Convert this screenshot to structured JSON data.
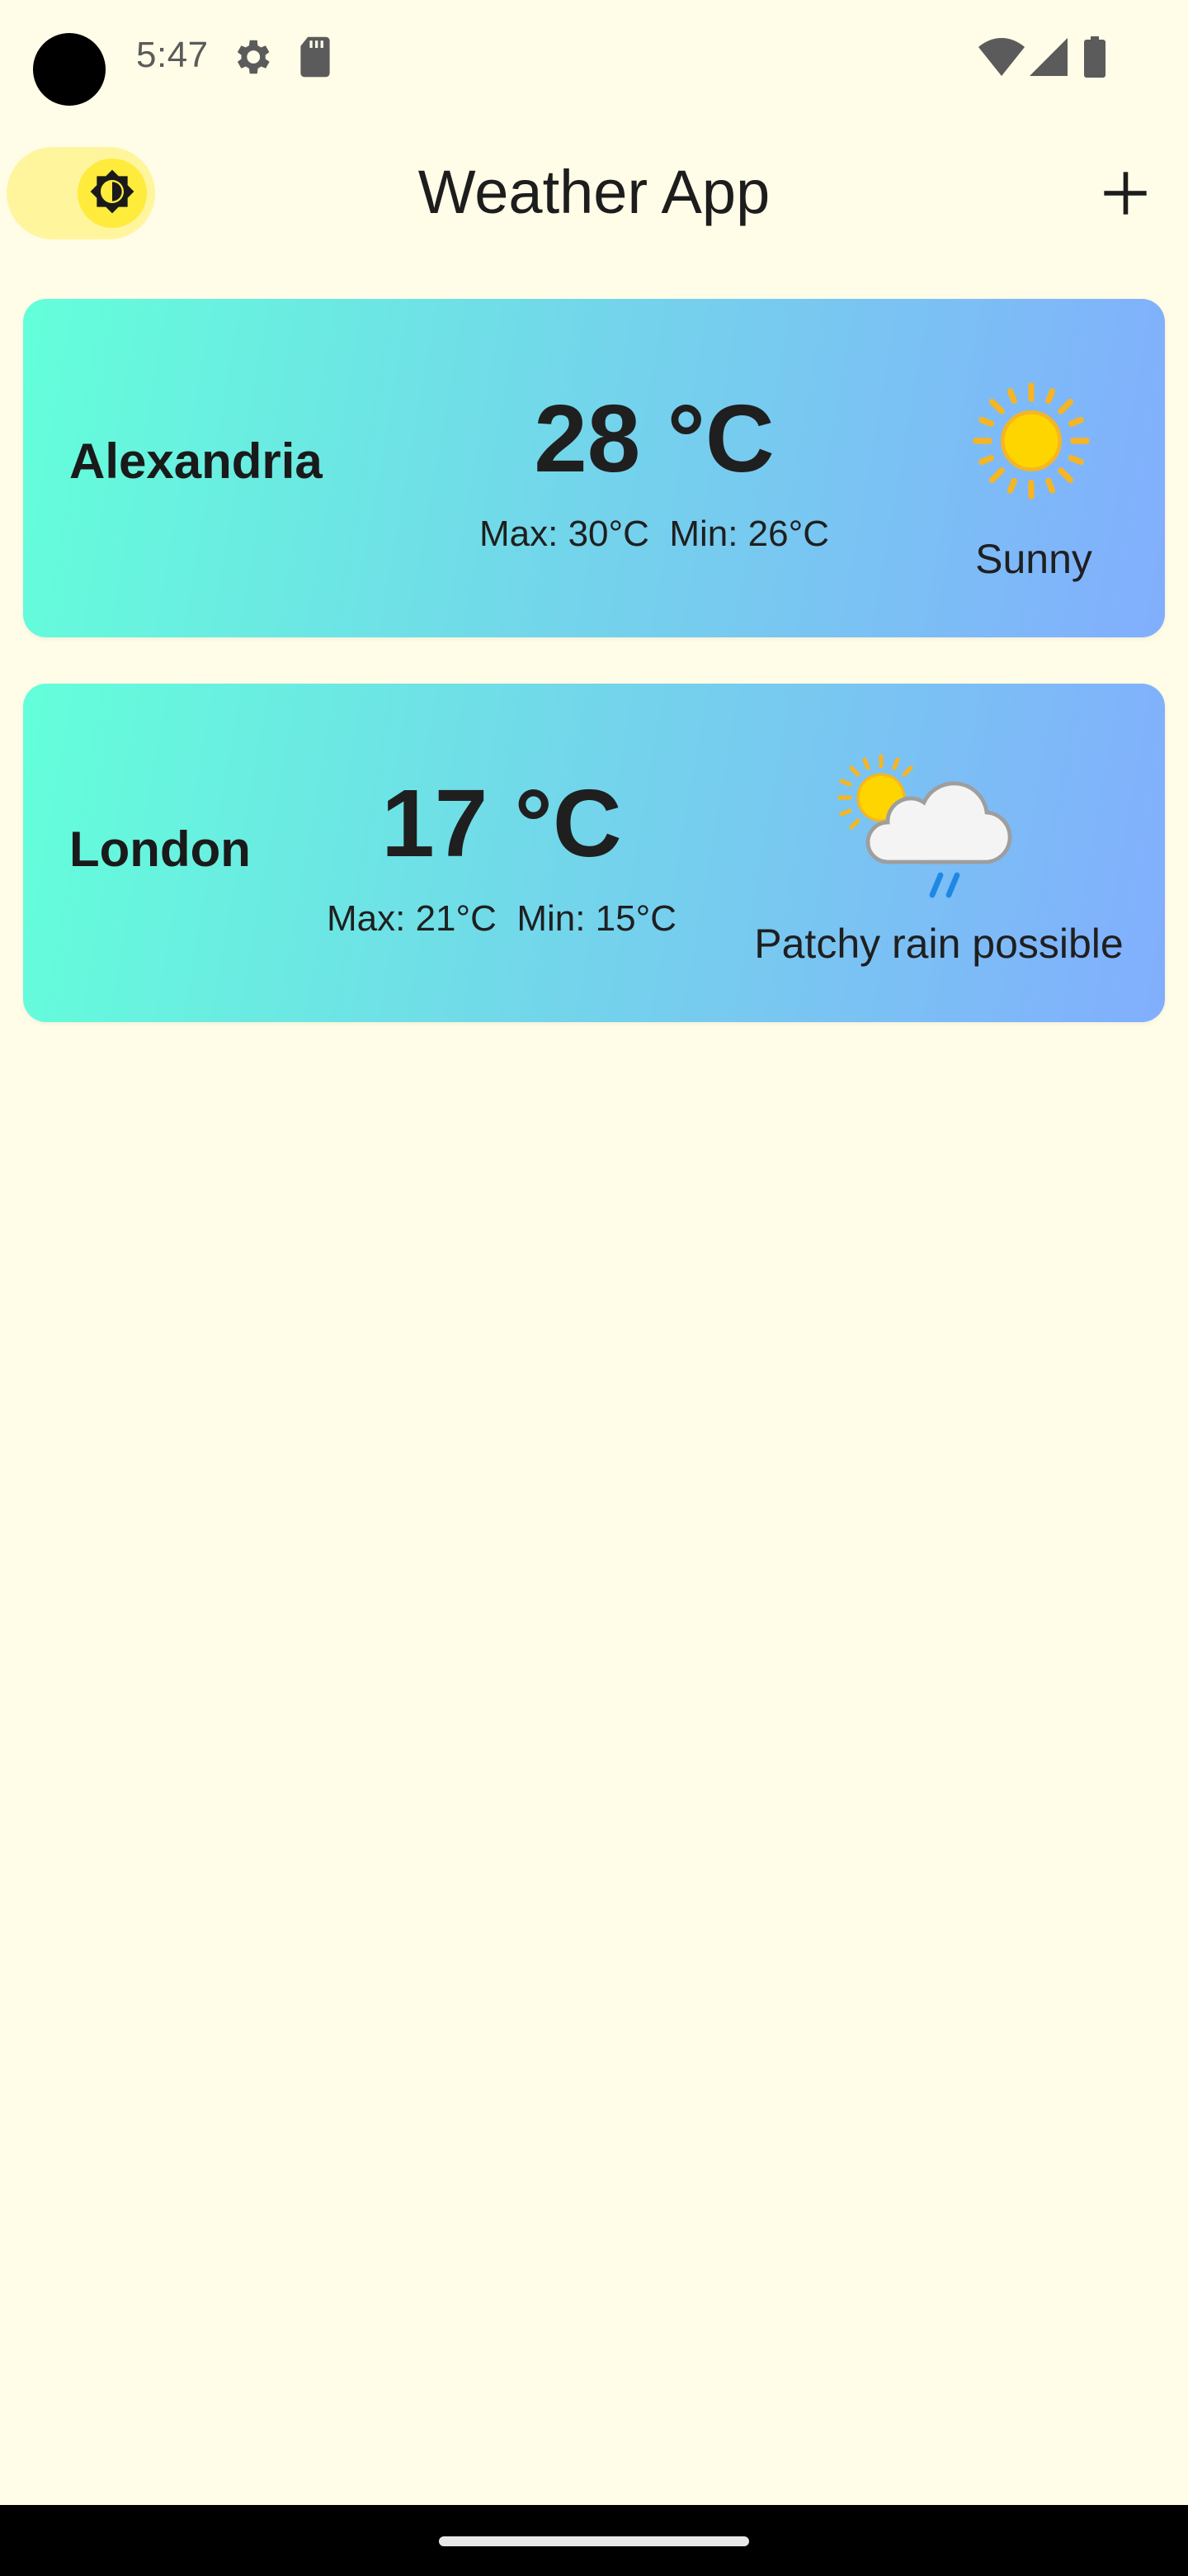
{
  "status_bar": {
    "time": "5:47",
    "icons": [
      "settings-icon",
      "sd-card-icon",
      "wifi-icon",
      "cellular-signal-icon",
      "battery-icon"
    ]
  },
  "app_bar": {
    "title": "Weather App",
    "theme_toggle_icon": "brightness-icon",
    "add_icon": "plus-icon"
  },
  "cards": [
    {
      "city": "Alexandria",
      "temperature": "28 °C",
      "max_min": "Max: 30°C  Min: 26°C",
      "condition": "Sunny",
      "icon": "sun-icon"
    },
    {
      "city": "London",
      "temperature": "17 °C",
      "max_min": "Max: 21°C  Min: 15°C",
      "condition": "Patchy rain possible",
      "icon": "sun-cloud-rain-icon"
    }
  ],
  "colors": {
    "background": "#FFFCE7",
    "card_gradient_start": "#63FFDA",
    "card_gradient_end": "#82AEFD",
    "toggle_track": "#FFF59D",
    "toggle_knob": "#FFEB3B"
  }
}
